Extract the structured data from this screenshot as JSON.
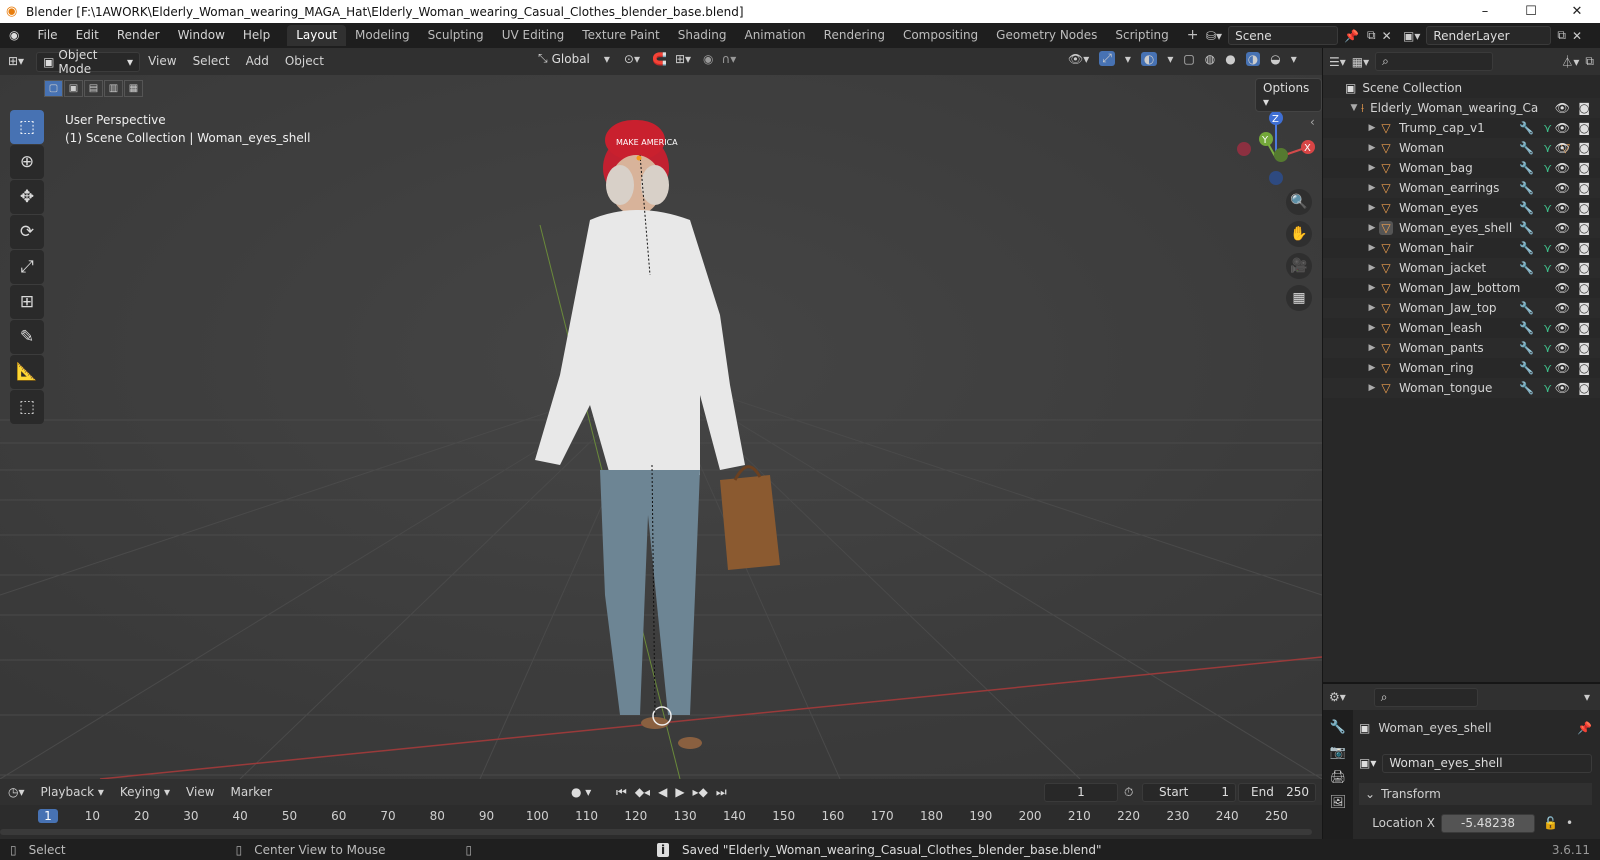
{
  "window": {
    "title": "Blender [F:\\1AWORK\\Elderly_Woman_wearing_MAGA_Hat\\Elderly_Woman_wearing_Casual_Clothes_blender_base.blend]",
    "min_icon": "minimize-icon",
    "max_icon": "maximize-icon",
    "close_icon": "close-icon"
  },
  "menu": [
    "File",
    "Edit",
    "Render",
    "Window",
    "Help"
  ],
  "workspaces": [
    "Layout",
    "Modeling",
    "Sculpting",
    "UV Editing",
    "Texture Paint",
    "Shading",
    "Animation",
    "Rendering",
    "Compositing",
    "Geometry Nodes",
    "Scripting"
  ],
  "active_workspace": "Layout",
  "scene": {
    "name": "Scene",
    "render_layer": "RenderLayer"
  },
  "viewport_header": {
    "mode": "Object Mode",
    "menus": [
      "View",
      "Select",
      "Add",
      "Object"
    ],
    "transform_orientation": "Global"
  },
  "viewport": {
    "perspective_label": "User Perspective",
    "context_label": "(1) Scene Collection | Woman_eyes_shell",
    "options_label": "Options",
    "gizmo": {
      "x": "X",
      "y": "Y",
      "z": "Z"
    }
  },
  "outliner": {
    "root": "Scene Collection",
    "collection": "Elderly_Woman_wearing_Ca",
    "items": [
      "Trump_cap_v1",
      "Woman",
      "Woman_bag",
      "Woman_earrings",
      "Woman_eyes",
      "Woman_eyes_shell",
      "Woman_hair",
      "Woman_jacket",
      "Woman_Jaw_bottom",
      "Woman_Jaw_top",
      "Woman_leash",
      "Woman_pants",
      "Woman_ring",
      "Woman_tongue"
    ],
    "selected": "Woman_eyes_shell"
  },
  "properties": {
    "object_name": "Woman_eyes_shell",
    "data_name": "Woman_eyes_shell",
    "panel": "Transform",
    "location_x_label": "Location X",
    "location_x_value": "-5.48238"
  },
  "timeline": {
    "menus": [
      "Playback",
      "Keying",
      "View",
      "Marker"
    ],
    "current_frame": "1",
    "start_label": "Start",
    "start_value": "1",
    "end_label": "End",
    "end_value": "250",
    "frames": [
      "1",
      "10",
      "20",
      "30",
      "40",
      "50",
      "60",
      "70",
      "80",
      "90",
      "100",
      "110",
      "120",
      "130",
      "140",
      "150",
      "160",
      "170",
      "180",
      "190",
      "200",
      "210",
      "220",
      "230",
      "240",
      "250"
    ]
  },
  "status": {
    "select": "Select",
    "center": "Center View to Mouse",
    "message": "Saved \"Elderly_Woman_wearing_Casual_Clothes_blender_base.blend\"",
    "version": "3.6.11"
  }
}
